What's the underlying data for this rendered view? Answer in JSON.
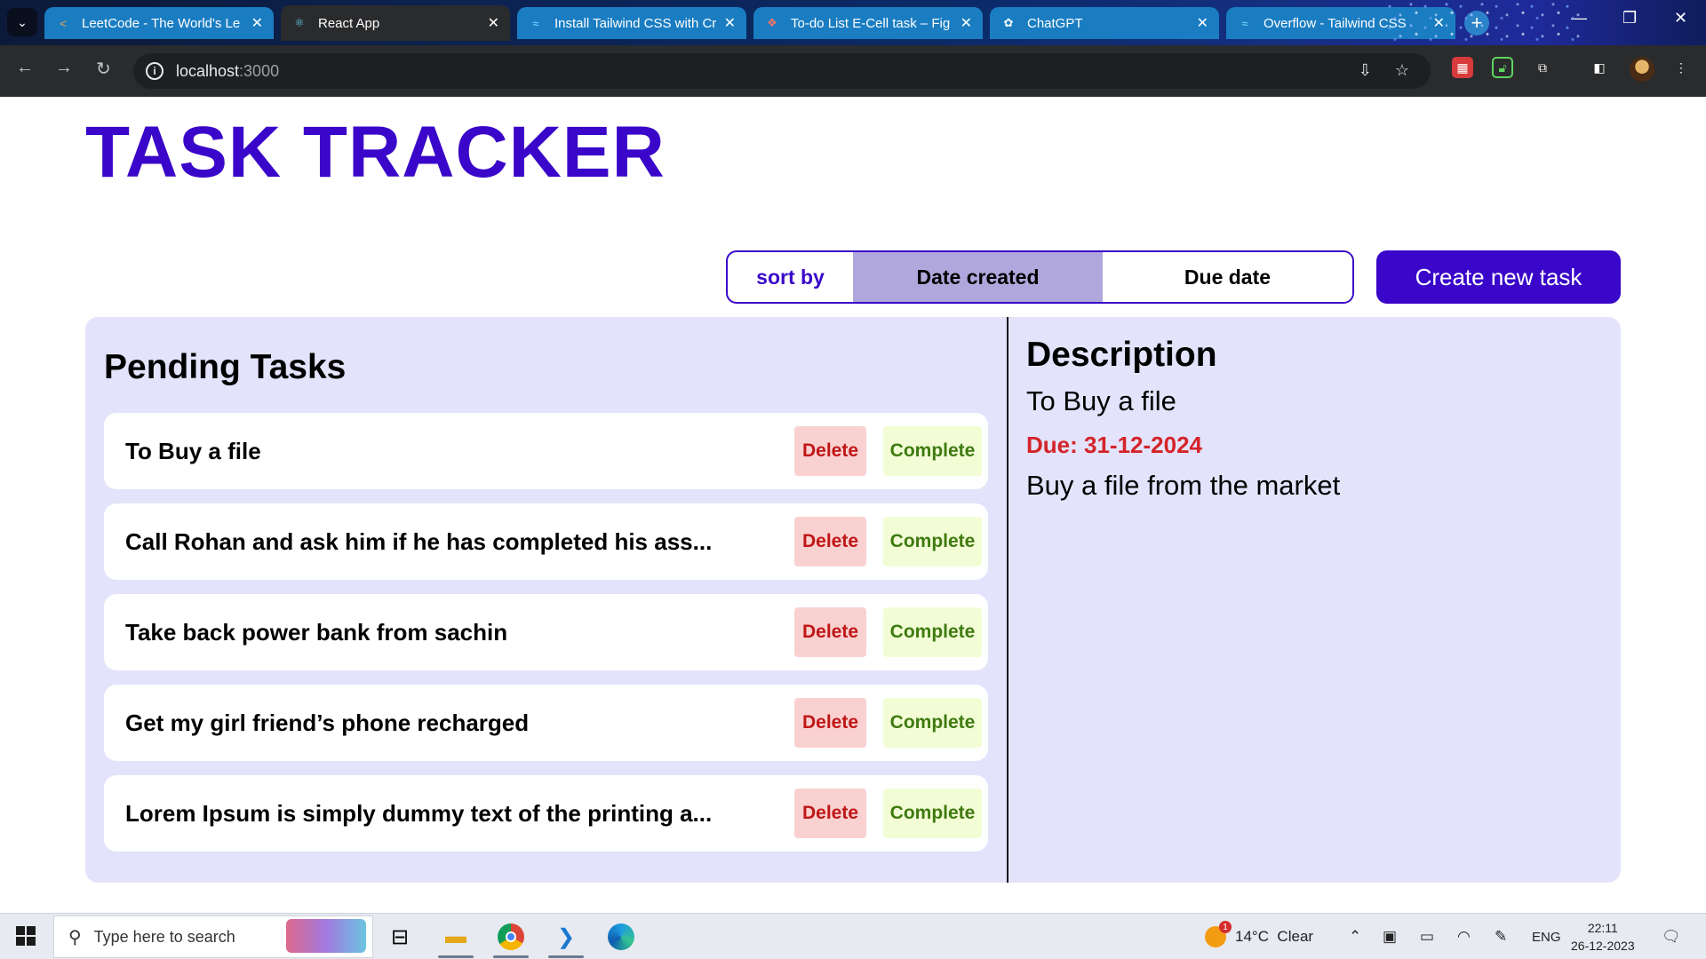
{
  "browser": {
    "tabs": [
      {
        "title": "LeetCode - The World's Le",
        "icon": "leetcode-icon",
        "active": false
      },
      {
        "title": "React App",
        "icon": "react-icon",
        "active": true
      },
      {
        "title": "Install Tailwind CSS with Cr",
        "icon": "tailwind-icon",
        "active": false
      },
      {
        "title": "To-do List E-Cell task – Fig",
        "icon": "figma-icon",
        "active": false
      },
      {
        "title": "ChatGPT",
        "icon": "chatgpt-icon",
        "active": false
      },
      {
        "title": "Overflow - Tailwind CSS",
        "icon": "tailwind-icon",
        "active": false
      }
    ],
    "url_host": "localhost",
    "url_port": ":3000"
  },
  "app": {
    "title": "TASK TRACKER",
    "sort": {
      "label": "sort by",
      "options": [
        "Date created",
        "Due date"
      ],
      "selected": "Date created"
    },
    "create_button": "Create new task",
    "pending_title": "Pending Tasks",
    "delete_label": "Delete",
    "complete_label": "Complete",
    "tasks": [
      "To Buy a file",
      "Call Rohan and ask him if he has completed his ass...",
      "Take back power bank from sachin",
      "Get my girl friend’s phone recharged",
      "Lorem Ipsum is simply dummy text of the printing a..."
    ],
    "description": {
      "heading": "Description",
      "title": "To Buy a file",
      "due": "Due: 31-12-2024",
      "body": "Buy a file from the market"
    }
  },
  "taskbar": {
    "search_placeholder": "Type here to search",
    "weather": "14°C  Clear",
    "weather_badge": "1",
    "language": "ENG",
    "time": "22:11",
    "date": "26-12-2023"
  },
  "colors": {
    "accent": "#3a06c9",
    "panel_bg": "#e3e3fb",
    "sort_selected": "#b0a8dc",
    "delete_bg": "#f9d1d1",
    "delete_text": "#c01616",
    "complete_bg": "#f2fdd6",
    "complete_text": "#3f7a0f",
    "due_text": "#d4242a"
  }
}
